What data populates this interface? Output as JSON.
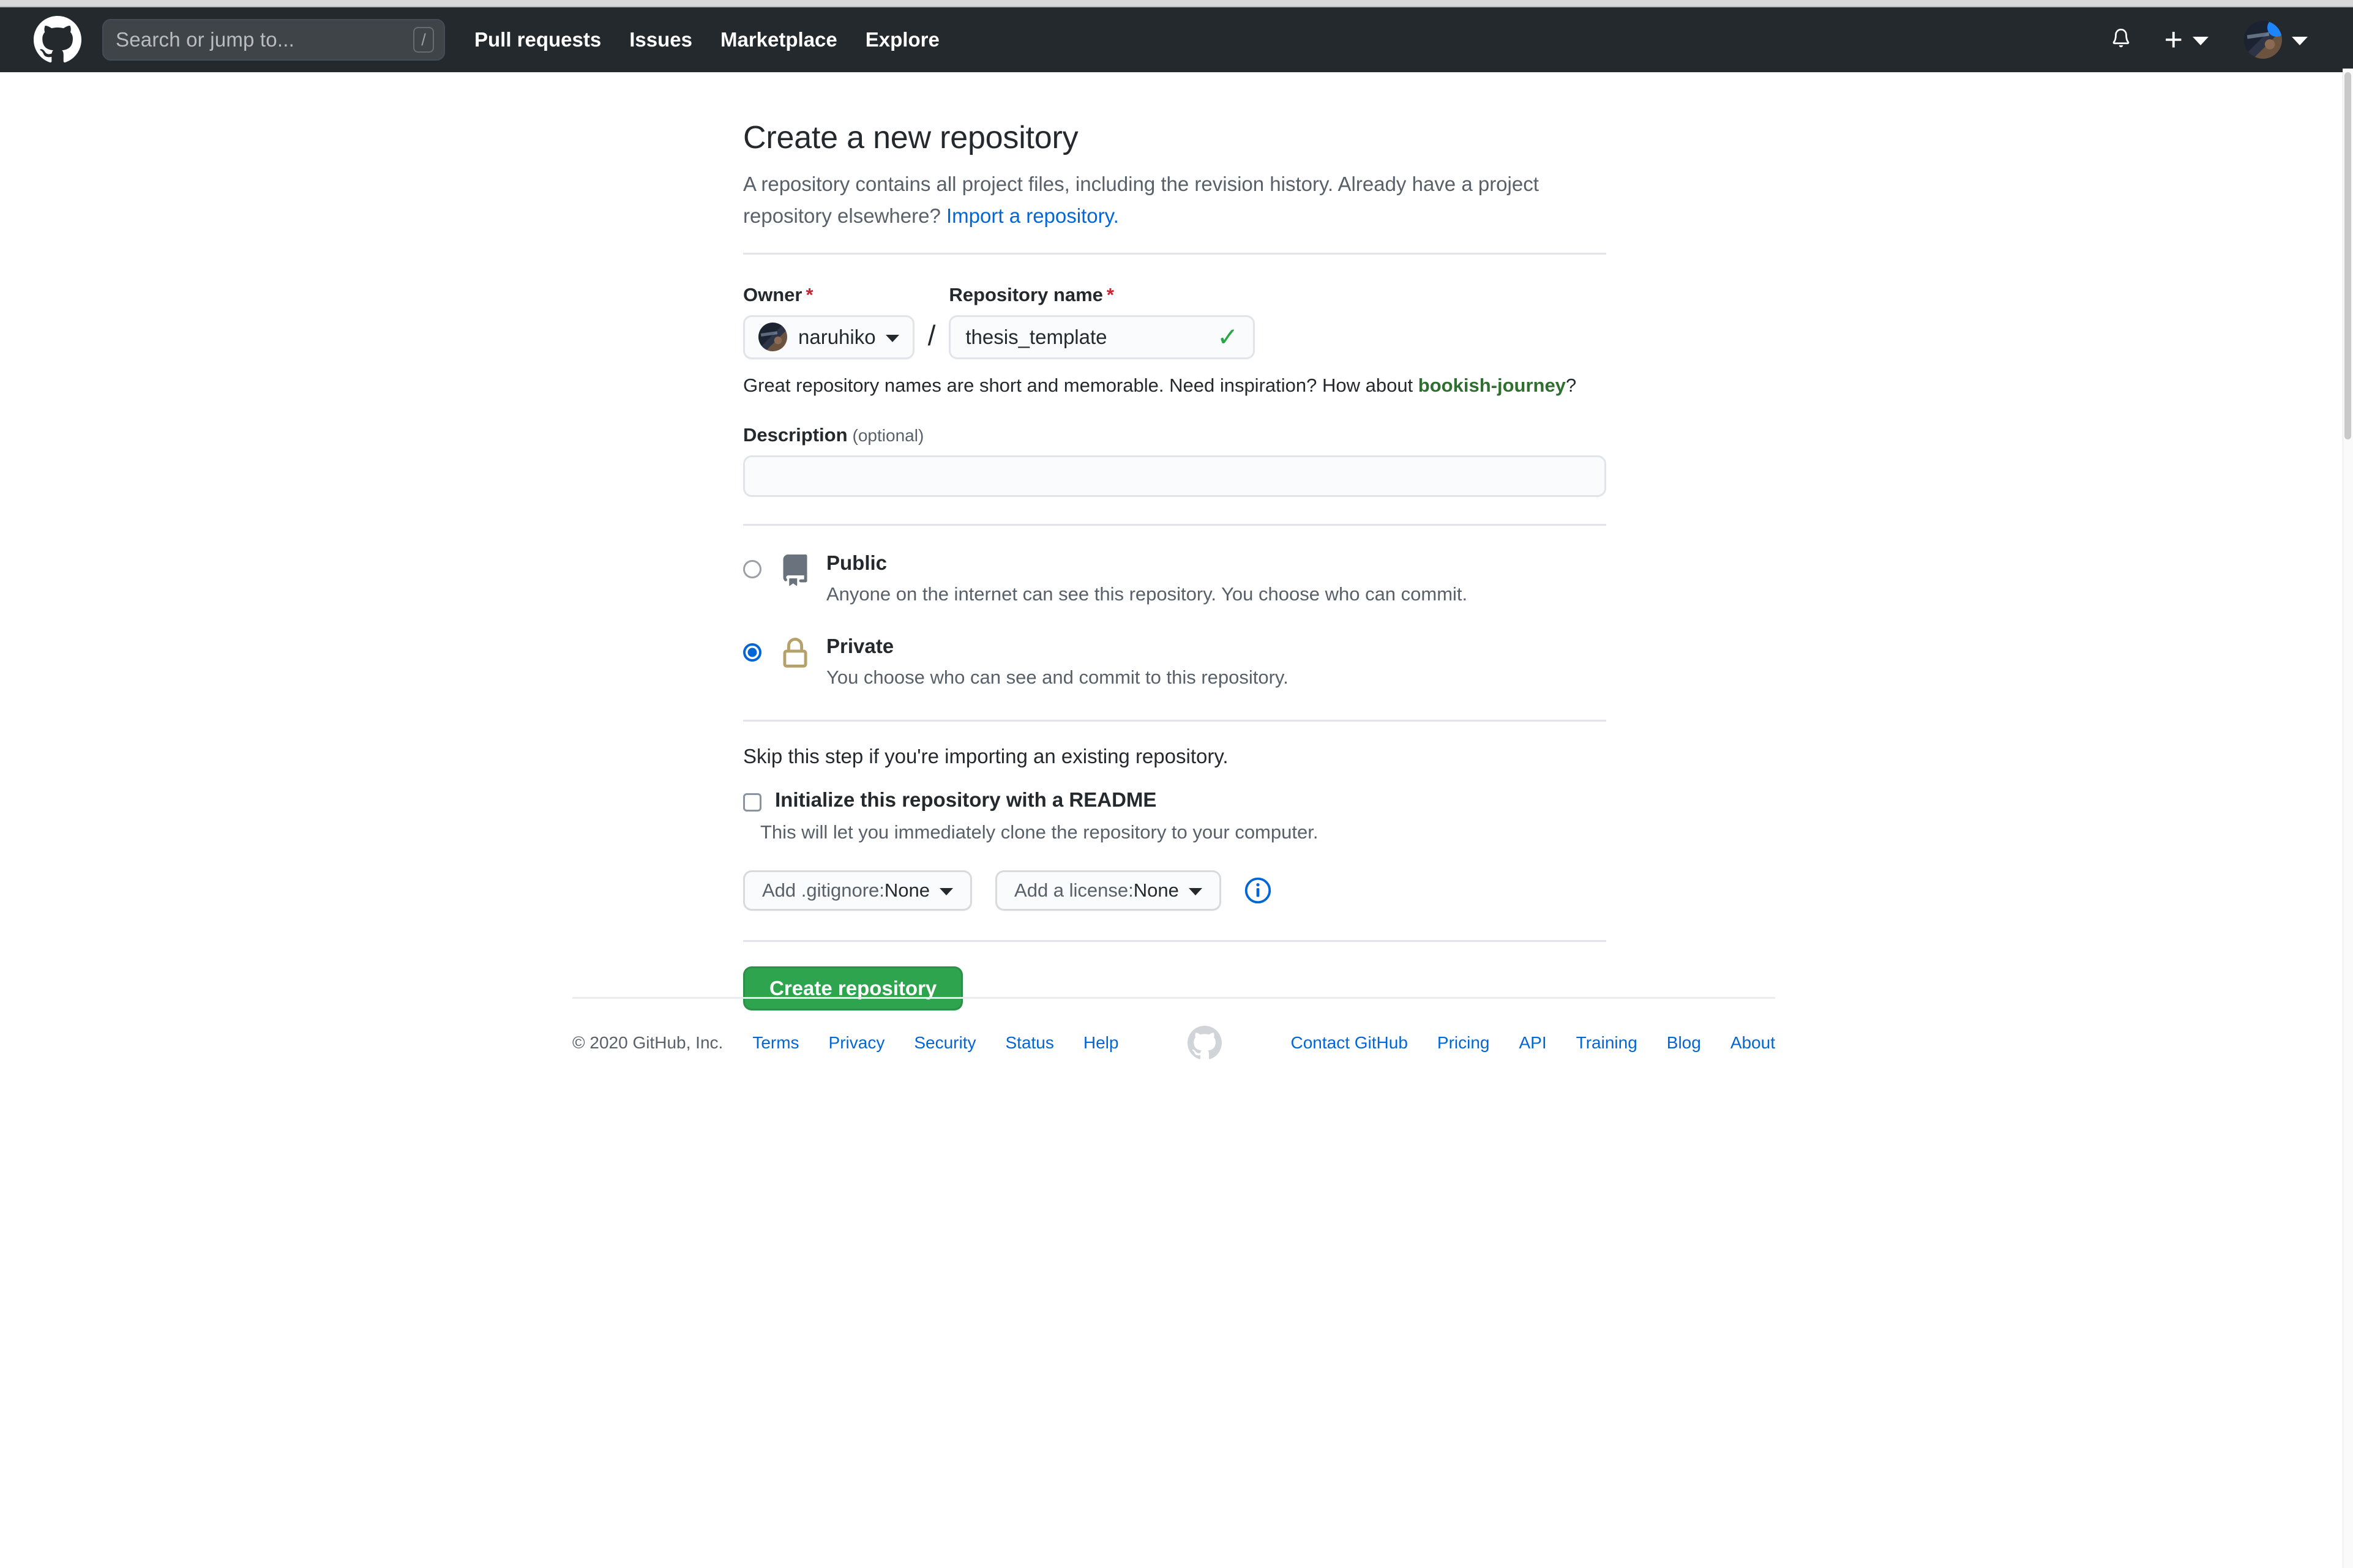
{
  "header": {
    "logo_icon": "github-mark-icon",
    "search": {
      "placeholder": "Search or jump to...",
      "shortcut_key": "/"
    },
    "nav": [
      {
        "label": "Pull requests"
      },
      {
        "label": "Issues"
      },
      {
        "label": "Marketplace"
      },
      {
        "label": "Explore"
      }
    ],
    "notifications_icon": "bell-icon",
    "create_new_icon": "plus-icon",
    "create_new_caret": "chevron-down-icon",
    "avatar_caret": "chevron-down-icon",
    "avatar_alt": "naruhiko",
    "has_unread_badge": true,
    "bg_color": "#24292e"
  },
  "main": {
    "title": "Create a new repository",
    "subtitle_part1": "A repository contains all project files, including the revision history. Already have a project repository elsewhere? ",
    "import_link": "Import a repository.",
    "owner": {
      "label": "Owner",
      "required_mark": "*",
      "value": "naruhiko",
      "caret_icon": "chevron-down-icon"
    },
    "separator": "/",
    "repository_name": {
      "label": "Repository name",
      "required_mark": "*",
      "value": "thesis_template",
      "valid_icon": "check-icon"
    },
    "name_hint": {
      "text_before": "Great repository names are short and memorable. Need inspiration? How about ",
      "suggestion": "bookish-journey",
      "text_after": "?"
    },
    "description": {
      "label": "Description",
      "optional_tag": "(optional)",
      "value": "",
      "placeholder": ""
    },
    "visibility": [
      {
        "id": "public",
        "title": "Public",
        "description": "Anyone on the internet can see this repository. You choose who can commit.",
        "selected": false,
        "icon": "repo-book-icon",
        "icon_color": "#6a737d"
      },
      {
        "id": "private",
        "title": "Private",
        "description": "You choose who can see and commit to this repository.",
        "selected": true,
        "icon": "lock-icon",
        "icon_color": "#b5a16b"
      }
    ],
    "skip_text": "Skip this step if you're importing an existing repository.",
    "readme": {
      "label": "Initialize this repository with a README",
      "description": "This will let you immediately clone the repository to your computer.",
      "checked": false
    },
    "gitignore_button": {
      "prefix": "Add .gitignore: ",
      "value": "None",
      "caret_icon": "chevron-down-icon"
    },
    "license_button": {
      "prefix": "Add a license: ",
      "value": "None",
      "caret_icon": "chevron-down-icon"
    },
    "info_icon": "info-circle-icon",
    "submit_button": "Create repository",
    "accent_green": "#2ea44f",
    "accent_blue": "#0366d6",
    "required_red": "#cb2431"
  },
  "footer": {
    "copyright": "© 2020 GitHub, Inc.",
    "mark_icon": "github-mark-icon",
    "left_links": [
      {
        "label": "Terms"
      },
      {
        "label": "Privacy"
      },
      {
        "label": "Security"
      },
      {
        "label": "Status"
      },
      {
        "label": "Help"
      }
    ],
    "right_links": [
      {
        "label": "Contact GitHub"
      },
      {
        "label": "Pricing"
      },
      {
        "label": "API"
      },
      {
        "label": "Training"
      },
      {
        "label": "Blog"
      },
      {
        "label": "About"
      }
    ]
  }
}
